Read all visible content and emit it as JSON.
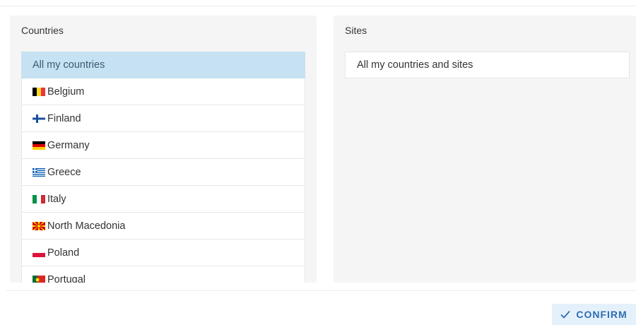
{
  "countries": {
    "title": "Countries",
    "items": [
      {
        "label": "All my countries",
        "selected": true,
        "flag": ""
      },
      {
        "label": "Belgium",
        "flag": "belgium-flag-icon"
      },
      {
        "label": "Finland",
        "flag": "finland-flag-icon"
      },
      {
        "label": "Germany",
        "flag": "germany-flag-icon"
      },
      {
        "label": "Greece",
        "flag": "greece-flag-icon"
      },
      {
        "label": "Italy",
        "flag": "italy-flag-icon"
      },
      {
        "label": "North Macedonia",
        "flag": "north-macedonia-flag-icon"
      },
      {
        "label": "Poland",
        "flag": "poland-flag-icon"
      },
      {
        "label": "Portugal",
        "flag": "portugal-flag-icon"
      }
    ]
  },
  "sites": {
    "title": "Sites",
    "items": [
      {
        "label": "All my countries and sites"
      }
    ]
  },
  "footer": {
    "confirm_label": "CONFIRM",
    "confirm_icon": "check-icon"
  },
  "colors": {
    "selected_bg": "#c5e1f2",
    "accent": "#2d6cb5",
    "panel_bg": "#f5f5f5"
  }
}
